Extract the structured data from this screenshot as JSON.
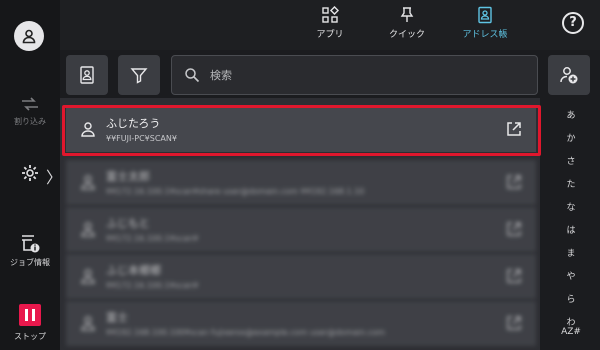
{
  "rail": {
    "interrupt_label": "割り込み",
    "job_info_label": "ジョブ情報",
    "stop_label": "ストップ",
    "stop_color": "#e8184c"
  },
  "tabs": [
    {
      "label": "アプリ",
      "icon": "apps-icon"
    },
    {
      "label": "クイック",
      "icon": "pin-icon"
    },
    {
      "label": "アドレス帳",
      "icon": "address-book-icon",
      "active": true
    }
  ],
  "accent_color": "#5fc4e4",
  "search": {
    "placeholder": "検索"
  },
  "list": {
    "selected": {
      "name": "ふじたろう",
      "path": "¥¥FUJI-PC¥SCAN¥"
    },
    "blurred_rows": [
      {
        "name": "富士太郎",
        "path": "¥¥172.16.100.1¥scan¥share  user@domain.com  ¥¥192.168.1.10"
      },
      {
        "name": "ふじもと",
        "path": "¥¥172.16.100.1¥scan¥"
      },
      {
        "name": "ふじ本郷郷",
        "path": "¥¥172.16.100.1¥scan¥"
      },
      {
        "name": "富士",
        "path": "¥¥192.168.100.100¥scan  fujixerox@example.com  user@domain.com"
      }
    ]
  },
  "kana_index": [
    "あ",
    "か",
    "さ",
    "た",
    "な",
    "は",
    "ま",
    "や",
    "ら",
    "わ",
    "AZ#"
  ],
  "highlight_color": "#e0172d"
}
